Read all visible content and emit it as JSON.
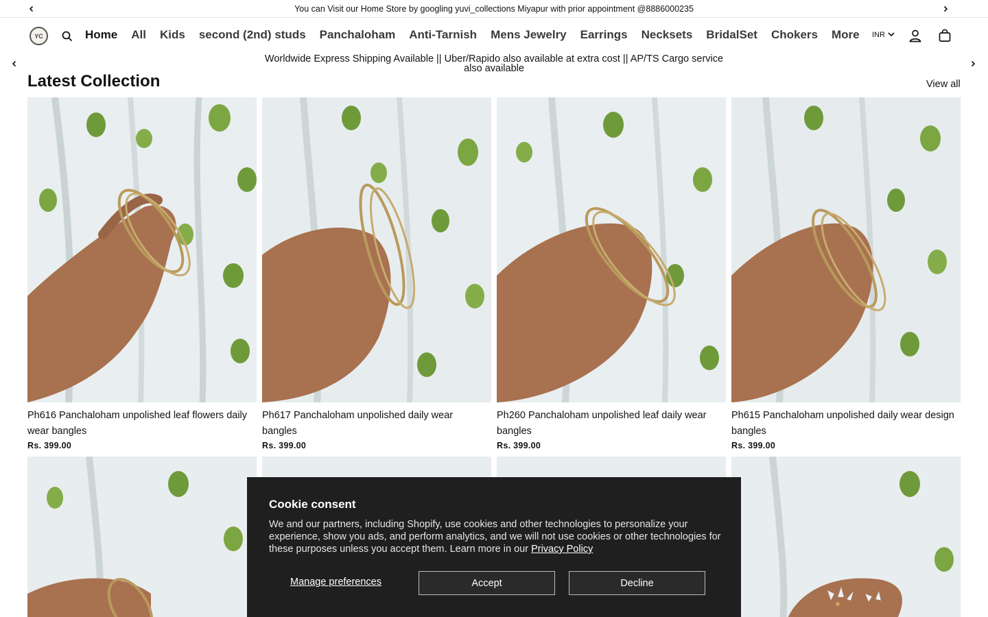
{
  "announcement": {
    "text": "You can Visit our Home Store by googling yuvi_collections Miyapur with prior appointment @8886000235",
    "prev_icon": "chevron-left-icon",
    "next_icon": "chevron-right-icon"
  },
  "header": {
    "logo_text": "YC",
    "nav": [
      "Home",
      "All",
      "Kids",
      "second (2nd) studs",
      "Panchaloham",
      "Anti-Tarnish",
      "Mens Jewelry",
      "Earrings",
      "Necksets",
      "BridalSet",
      "Chokers",
      "More"
    ],
    "currency": "INR",
    "icons": [
      "search-icon",
      "account-icon",
      "cart-icon",
      "chevron-down-icon"
    ]
  },
  "shipping_banner": {
    "text": "Worldwide Express Shipping Available || Uber/Rapido also available at extra cost || AP/TS Cargo service also available"
  },
  "collection": {
    "title": "Latest Collection",
    "view_all": "View all",
    "products": [
      {
        "title": "Ph616 Panchaloham unpolished leaf flowers daily wear bangles",
        "price": "Rs. 399.00"
      },
      {
        "title": "Ph617 Panchaloham unpolished daily wear bangles",
        "price": "Rs. 399.00"
      },
      {
        "title": "Ph260 Panchaloham unpolished leaf daily wear bangles",
        "price": "Rs. 399.00"
      },
      {
        "title": "Ph615 Panchaloham unpolished daily wear design bangles",
        "price": "Rs. 399.00"
      }
    ]
  },
  "cookie": {
    "title": "Cookie consent",
    "body": "We and our partners, including Shopify, use cookies and other technologies to personalize your experience, show you ads, and perform analytics, and we will not use cookies or other technologies for these purposes unless you accept them. Learn more in our ",
    "policy_link": "Privacy Policy",
    "manage": "Manage preferences",
    "accept": "Accept",
    "decline": "Decline"
  },
  "colors": {
    "text": "#121212",
    "cookie_bg": "#1f1f1f",
    "skin": "#a8714f",
    "leaf": "#6f9a3a",
    "bangle": "#b89a5c"
  }
}
